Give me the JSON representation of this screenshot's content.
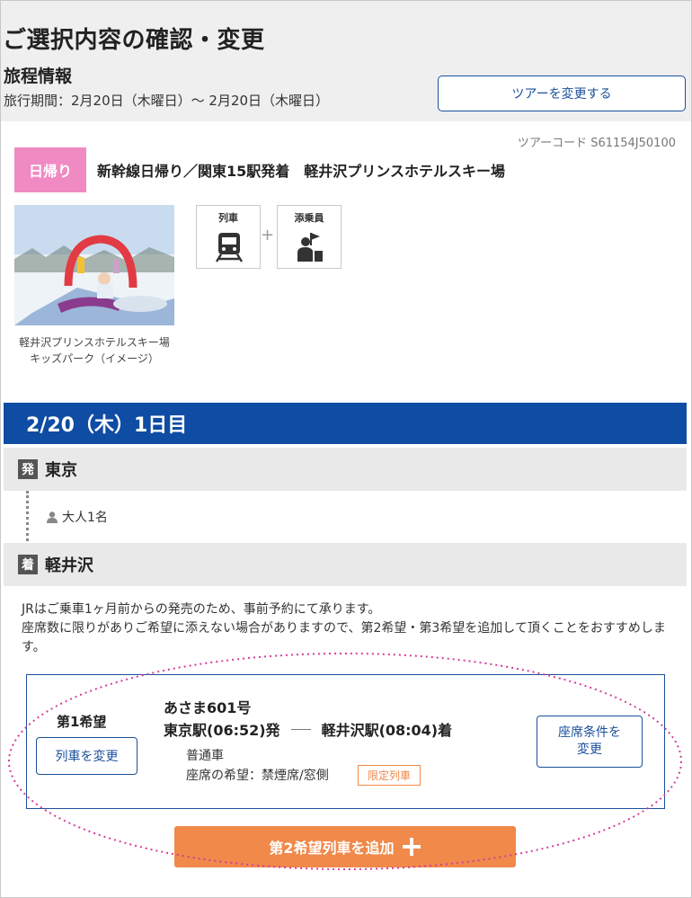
{
  "header": {
    "page_title": "ご選択内容の確認・変更",
    "section_title": "旅程情報",
    "period": "旅行期間：2月20日（木曜日）～ 2月20日（木曜日）",
    "change_tour_label": "ツアーを変更する"
  },
  "tour": {
    "code": "ツアーコード S61154J50100",
    "badge": "日帰り",
    "name": "新幹線日帰り／関東15駅発着　軽井沢プリンスホテルスキー場",
    "photo_caption": "軽井沢プリンスホテルスキー場　キッズパーク（イメージ）",
    "features": [
      {
        "label": "列車",
        "icon": "train-icon"
      },
      {
        "label": "添乗員",
        "icon": "tour-guide-icon"
      }
    ],
    "plus_sign": "+"
  },
  "day": {
    "header": "2/20（木）1日目",
    "departure": {
      "mark": "発",
      "station": "東京"
    },
    "passengers": "大人1名",
    "arrival": {
      "mark": "着",
      "station": "軽井沢"
    }
  },
  "notice": [
    "JRはご乗車1ヶ月前からの発売のため、事前予約にて承ります。",
    "座席数に限りがありご希望に添えない場合がありますので、第2希望・第3希望を追加して頂くことをおすすめします。"
  ],
  "choice": {
    "rank": "第1希望",
    "change_train_label": "列車を変更",
    "train_name": "あさま601号",
    "depart": "東京駅(06:52)発",
    "arrive": "軽井沢駅(08:04)着",
    "car_class": "普通車",
    "seat_pref": "座席の希望：禁煙席/窓側",
    "limited_tag": "限定列車",
    "seat_cond_label_1": "座席条件を",
    "seat_cond_label_2": "変更"
  },
  "add_button": {
    "label": "第2希望列車を追加",
    "icon": "plus-icon"
  },
  "colors": {
    "brand_blue": "#0f4ca3",
    "badge_pink": "#f08ac3",
    "add_orange": "#f0894a",
    "highlight_dots": "#d63c9a"
  }
}
